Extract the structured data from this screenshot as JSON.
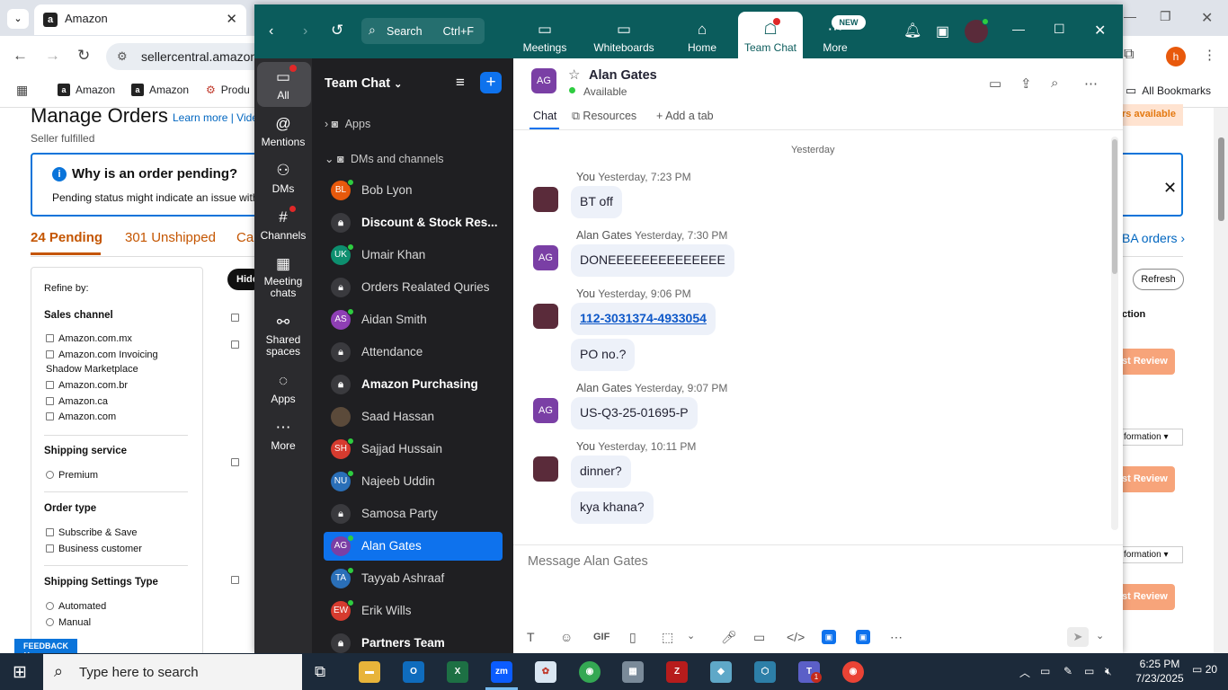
{
  "browser": {
    "tab_title": "Amazon",
    "url": "sellercentral.amazon",
    "bookmarks": [
      "Amazon",
      "Amazon",
      "Produ"
    ],
    "all_bookmarks": "All Bookmarks",
    "profile_initial": "h"
  },
  "amazon": {
    "title": "Manage Orders",
    "learn_more": "Learn more",
    "video": "Vide",
    "seller_fulfilled": "Seller fulfilled",
    "info_title": "Why is an order pending?",
    "info_text": "Pending status might indicate an issue with t",
    "tab_pending": "24 Pending",
    "tab_unshipped": "301 Unshipped",
    "tab_cancel": "Can",
    "hide_btn": "Hide",
    "refine_by": "Refine by:",
    "sales_channel": "Sales channel",
    "channels": [
      "Amazon.com.mx",
      "Amazon.com Invoicing",
      "Shadow Marketplace",
      "Amazon.com.br",
      "Amazon.ca",
      "Amazon.com"
    ],
    "shipping_service": "Shipping service",
    "premium": "Premium",
    "order_type": "Order type",
    "order_types": [
      "Subscribe & Save",
      "Business customer"
    ],
    "shipping_settings": "Shipping Settings Type",
    "settings_types": [
      "Automated",
      "Manual"
    ],
    "feedback": "FEEDBACK",
    "avail_right": "rs available",
    "fba_orders": "BA orders",
    "refresh": "Refresh",
    "action_col": "ction",
    "review": "st Review",
    "information": "formation"
  },
  "zoom": {
    "search_placeholder": "Search",
    "search_shortcut": "Ctrl+F",
    "nav": [
      {
        "label": "Meetings"
      },
      {
        "label": "Whiteboards"
      },
      {
        "label": "Home"
      },
      {
        "label": "Team Chat"
      },
      {
        "label": "More"
      }
    ],
    "new_badge": "NEW",
    "rail": [
      {
        "label": "All"
      },
      {
        "label": "Mentions"
      },
      {
        "label": "DMs"
      },
      {
        "label": "Channels"
      },
      {
        "label": "Meeting chats"
      },
      {
        "label": "Shared spaces"
      },
      {
        "label": "Apps"
      },
      {
        "label": "More"
      }
    ],
    "sidebar_title": "Team Chat",
    "group_apps": "Apps",
    "group_dms": "DMs and channels",
    "contacts": [
      {
        "name": "Bob Lyon",
        "initials": "BL",
        "color": "#e8590c",
        "lock": false,
        "bold": false,
        "online": true
      },
      {
        "name": "Discount & Stock Res...",
        "initials": "",
        "color": "",
        "lock": true,
        "bold": true,
        "online": false
      },
      {
        "name": "Umair Khan",
        "initials": "UK",
        "color": "#0d8f6f",
        "lock": false,
        "bold": false,
        "online": true
      },
      {
        "name": "Orders Realated Quries",
        "initials": "",
        "color": "",
        "lock": true,
        "bold": false,
        "online": false
      },
      {
        "name": "Aidan Smith",
        "initials": "AS",
        "color": "#8e3fb5",
        "lock": false,
        "bold": false,
        "online": true
      },
      {
        "name": "Attendance",
        "initials": "",
        "color": "",
        "lock": true,
        "bold": false,
        "online": false
      },
      {
        "name": "Amazon Purchasing",
        "initials": "",
        "color": "",
        "lock": true,
        "bold": true,
        "online": false
      },
      {
        "name": "Saad Hassan",
        "initials": "",
        "color": "#5b4a3a",
        "lock": false,
        "bold": false,
        "online": false
      },
      {
        "name": "Sajjad Hussain",
        "initials": "SH",
        "color": "#d63b2f",
        "lock": false,
        "bold": false,
        "online": true
      },
      {
        "name": "Najeeb Uddin",
        "initials": "NU",
        "color": "#2a6fb8",
        "lock": false,
        "bold": false,
        "online": true
      },
      {
        "name": "Samosa Party",
        "initials": "",
        "color": "",
        "lock": true,
        "bold": false,
        "online": false
      },
      {
        "name": "Alan Gates",
        "initials": "AG",
        "color": "#7a3fa5",
        "lock": false,
        "bold": false,
        "online": true
      },
      {
        "name": "Tayyab Ashraaf",
        "initials": "TA",
        "color": "#2a6fb8",
        "lock": false,
        "bold": false,
        "online": true
      },
      {
        "name": "Erik Wills",
        "initials": "EW",
        "color": "#d63b2f",
        "lock": false,
        "bold": false,
        "online": true
      },
      {
        "name": "Partners Team",
        "initials": "",
        "color": "",
        "lock": true,
        "bold": true,
        "online": false
      }
    ],
    "chat": {
      "contact_name": "Alan Gates",
      "contact_initials": "AG",
      "status": "Available",
      "tab_chat": "Chat",
      "tab_resources": "Resources",
      "tab_add": "Add a tab",
      "day_separator": "Yesterday",
      "messages": [
        {
          "sender": "You",
          "time": "Yesterday, 7:23 PM",
          "bubbles": [
            "BT off"
          ]
        },
        {
          "sender": "Alan Gates",
          "time": "Yesterday, 7:30 PM",
          "bubbles": [
            "DONEEEEEEEEEEEEEE"
          ]
        },
        {
          "sender": "You",
          "time": "Yesterday, 9:06 PM",
          "bubbles": [
            "112-3031374-4933054",
            "PO no.?"
          ]
        },
        {
          "sender": "Alan Gates",
          "time": "Yesterday, 9:07 PM",
          "bubbles": [
            "US-Q3-25-01695-P"
          ]
        },
        {
          "sender": "You",
          "time": "Yesterday, 10:11 PM",
          "bubbles": [
            "dinner?",
            "kya khana?"
          ]
        }
      ],
      "input_placeholder": "Message Alan Gates",
      "gif_label": "GIF"
    }
  },
  "taskbar": {
    "search": "Type here to search",
    "time": "6:25 PM",
    "date": "7/23/2025",
    "notifications": "20",
    "teams_badge": "1"
  }
}
